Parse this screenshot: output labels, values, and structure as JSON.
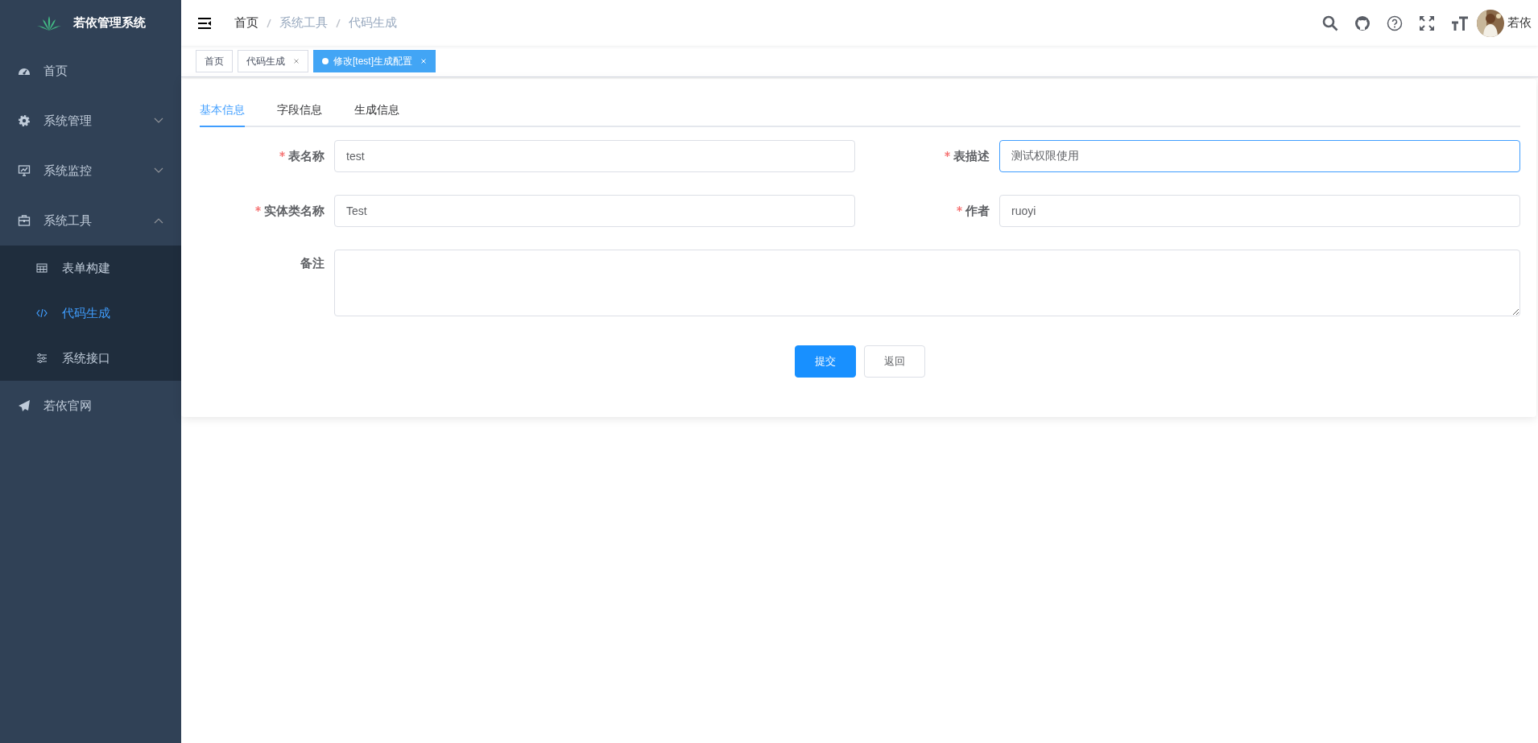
{
  "sidebar": {
    "logo_text": "若依管理系统",
    "items": [
      {
        "label": "首页"
      },
      {
        "label": "系统管理",
        "expanded": false
      },
      {
        "label": "系统监控",
        "expanded": false
      },
      {
        "label": "系统工具",
        "expanded": true,
        "children": [
          {
            "label": "表单构建",
            "selected": false
          },
          {
            "label": "代码生成",
            "selected": true
          },
          {
            "label": "系统接口",
            "selected": false
          }
        ]
      },
      {
        "label": "若依官网"
      }
    ]
  },
  "header": {
    "breadcrumb": [
      "首页",
      "系统工具",
      "代码生成"
    ],
    "user_name": "若依"
  },
  "tags": [
    {
      "label": "首页",
      "selected": false,
      "closable": false
    },
    {
      "label": "代码生成",
      "selected": false,
      "closable": true
    },
    {
      "label": "修改[test]生成配置",
      "selected": true,
      "closable": true
    }
  ],
  "form_tabs": [
    {
      "label": "基本信息",
      "selected": true
    },
    {
      "label": "字段信息",
      "selected": false
    },
    {
      "label": "生成信息",
      "selected": false
    }
  ],
  "fields": [
    {
      "label": "表名称",
      "required": true,
      "value": "test",
      "focused": false,
      "kind": "input"
    },
    {
      "label": "表描述",
      "required": true,
      "value": "测试权限使用",
      "focused": true,
      "kind": "input"
    },
    {
      "label": "实体类名称",
      "required": true,
      "value": "Test",
      "focused": false,
      "kind": "input"
    },
    {
      "label": "作者",
      "required": true,
      "value": "ruoyi",
      "focused": false,
      "kind": "input"
    },
    {
      "label": "备注",
      "required": false,
      "focused": false,
      "kind": "textarea"
    }
  ],
  "buttons": [
    {
      "label": "提交",
      "kind": "primary"
    },
    {
      "label": "返回",
      "kind": "default"
    }
  ]
}
